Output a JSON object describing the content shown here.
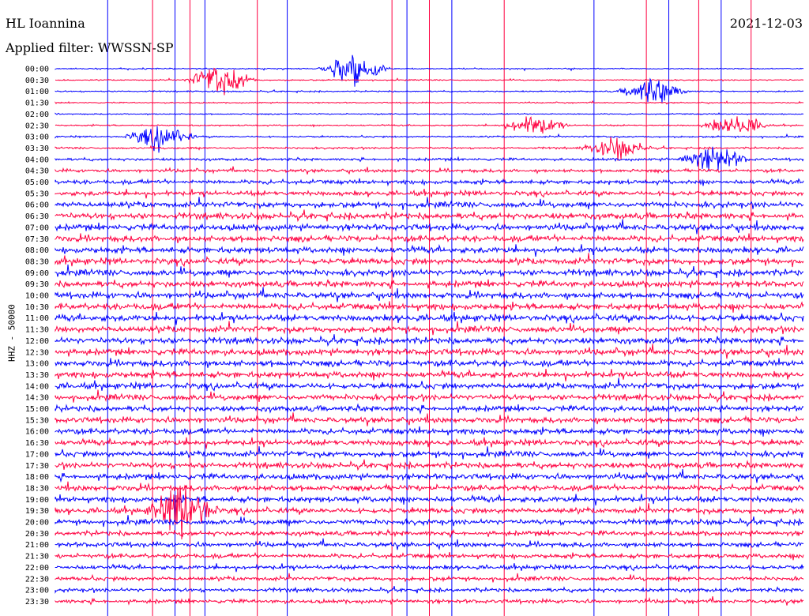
{
  "header": {
    "station": "HL Ioannina",
    "filter": "Applied filter: WWSSN-SP",
    "date": "2021-12-03"
  },
  "colors": {
    "even_trace": "#0000ff",
    "odd_trace": "#ff0040",
    "background": "#ffffff"
  },
  "chart_data": {
    "type": "line",
    "title": "HL Ioannina",
    "subtitle": "Applied filter: WWSSN-SP",
    "ylabel": "HHZ - 50000",
    "date": "2021-12-03",
    "rows": [
      "00:00",
      "00:30",
      "01:00",
      "01:30",
      "02:00",
      "02:30",
      "03:00",
      "03:30",
      "04:00",
      "04:30",
      "05:00",
      "05:30",
      "06:00",
      "06:30",
      "07:00",
      "07:30",
      "08:00",
      "08:30",
      "09:00",
      "09:30",
      "10:00",
      "10:30",
      "11:00",
      "11:30",
      "12:00",
      "12:30",
      "13:00",
      "13:30",
      "14:00",
      "14:30",
      "15:00",
      "15:30",
      "16:00",
      "16:30",
      "17:00",
      "17:30",
      "18:00",
      "18:30",
      "19:00",
      "19:30",
      "20:00",
      "20:30",
      "21:00",
      "21:30",
      "22:00",
      "22:30",
      "23:00",
      "23:30"
    ],
    "row_noise_level": [
      0.25,
      0.25,
      0.3,
      0.25,
      0.25,
      0.3,
      0.35,
      0.4,
      0.55,
      0.7,
      0.9,
      1.0,
      1.2,
      1.3,
      1.3,
      1.3,
      1.3,
      1.3,
      1.3,
      1.3,
      1.3,
      1.35,
      1.35,
      1.3,
      1.3,
      1.3,
      1.3,
      1.3,
      1.25,
      1.2,
      1.2,
      1.2,
      1.2,
      1.2,
      1.2,
      1.2,
      1.2,
      1.2,
      1.2,
      1.15,
      1.1,
      1.0,
      1.0,
      0.95,
      0.9,
      0.85,
      0.8,
      0.8
    ],
    "events": [
      {
        "row": "00:00",
        "time_fraction": 0.4,
        "amplitude": 3.0
      },
      {
        "row": "00:30",
        "time_fraction": 0.22,
        "amplitude": 3.0
      },
      {
        "row": "01:00",
        "time_fraction": 0.8,
        "amplitude": 2.5
      },
      {
        "row": "02:30",
        "time_fraction": 0.64,
        "amplitude": 1.8
      },
      {
        "row": "02:30",
        "time_fraction": 0.91,
        "amplitude": 2.0
      },
      {
        "row": "03:00",
        "time_fraction": 0.14,
        "amplitude": 2.2
      },
      {
        "row": "03:30",
        "time_fraction": 0.75,
        "amplitude": 2.0
      },
      {
        "row": "04:00",
        "time_fraction": 0.88,
        "amplitude": 2.5
      },
      {
        "row": "19:30",
        "time_fraction": 0.17,
        "amplitude": 4.5
      }
    ],
    "spikes": [
      {
        "time_fraction": 0.07
      },
      {
        "time_fraction": 0.13
      },
      {
        "time_fraction": 0.16
      },
      {
        "time_fraction": 0.18
      },
      {
        "time_fraction": 0.2
      },
      {
        "time_fraction": 0.27
      },
      {
        "time_fraction": 0.31
      },
      {
        "time_fraction": 0.45
      },
      {
        "time_fraction": 0.47
      },
      {
        "time_fraction": 0.5
      },
      {
        "time_fraction": 0.53
      },
      {
        "time_fraction": 0.6
      },
      {
        "time_fraction": 0.72
      },
      {
        "time_fraction": 0.79
      },
      {
        "time_fraction": 0.82
      },
      {
        "time_fraction": 0.86
      },
      {
        "time_fraction": 0.89
      },
      {
        "time_fraction": 0.93
      }
    ]
  }
}
